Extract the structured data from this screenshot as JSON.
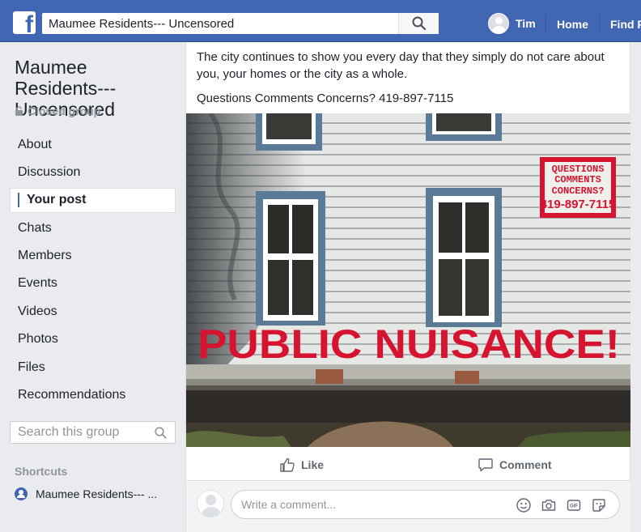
{
  "topbar": {
    "logo": "f",
    "search_value": "Maumee Residents--- Uncensored",
    "user_name": "Tim",
    "home_label": "Home",
    "find_friends_label": "Find F"
  },
  "sidebar": {
    "group_name": "Maumee Residents--- Uncensored",
    "group_type": "Closed group",
    "items": [
      {
        "label": "About"
      },
      {
        "label": "Discussion"
      },
      {
        "label": "Your post"
      },
      {
        "label": "Chats"
      },
      {
        "label": "Members"
      },
      {
        "label": "Events"
      },
      {
        "label": "Videos"
      },
      {
        "label": "Photos"
      },
      {
        "label": "Files"
      },
      {
        "label": "Recommendations"
      }
    ],
    "active_index": 2,
    "search_placeholder": "Search this group",
    "shortcuts_title": "Shortcuts",
    "shortcut_item": "Maumee Residents--- ..."
  },
  "post": {
    "text_1": "The city continues to show you every day that they simply do not care about you, your homes or the city as a whole.",
    "text_2": "Questions Comments Concerns? 419-897-7115",
    "photo": {
      "mural_text": "PUBLIC NUISANCE!",
      "sign_lines": [
        "QUESTIONS",
        "COMMENTS",
        "CONCERNS?",
        "419-897-7115"
      ]
    },
    "like_label": "Like",
    "comment_label": "Comment",
    "comment_placeholder": "Write a comment..."
  },
  "colors": {
    "brand": "#4267b2",
    "mural_red": "#d7142f"
  }
}
